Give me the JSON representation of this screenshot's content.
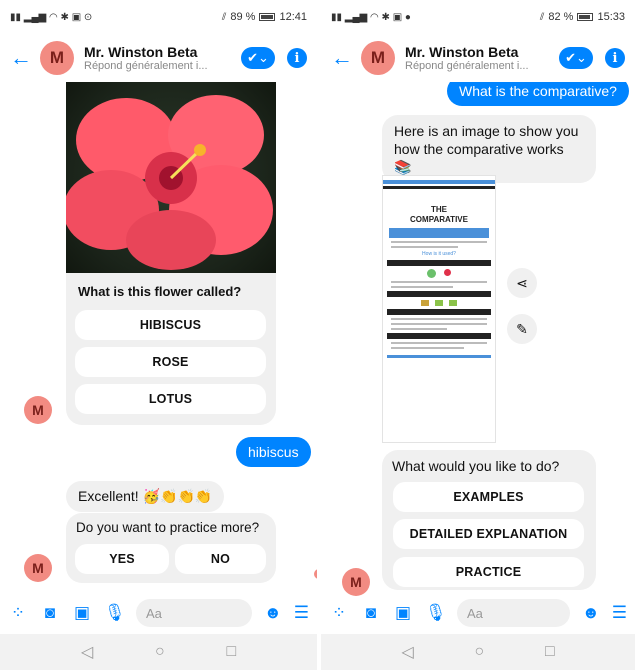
{
  "left": {
    "status": {
      "battery": "89 %",
      "time": "12:41"
    },
    "header": {
      "avatar_letter": "M",
      "name": "Mr. Winston Beta",
      "subtitle": "Répond généralement i..."
    },
    "question": "What is this flower called?",
    "options": [
      "HIBISCUS",
      "ROSE",
      "LOTUS"
    ],
    "user_reply": "hibiscus",
    "feedback": "Excellent! 🥳👏👏👏",
    "prompt": "Do you want to practice more?",
    "yes_no": [
      "YES",
      "NO"
    ],
    "avatar_letter": "M",
    "composer_placeholder": "Aa"
  },
  "right": {
    "status": {
      "battery": "82 %",
      "time": "15:33"
    },
    "header": {
      "avatar_letter": "M",
      "name": "Mr. Winston Beta",
      "subtitle": "Répond généralement i..."
    },
    "user_question": "What is the comparative?",
    "bot_reply": "Here is an image to show you how the comparative works 📚",
    "infographic": {
      "title_line1": "THE",
      "title_line2": "COMPARATIVE",
      "subheading": "How is it used?"
    },
    "prompt": "What would you like to do?",
    "options": [
      "EXAMPLES",
      "DETAILED EXPLANATION",
      "PRACTICE"
    ],
    "avatar_letter": "M",
    "composer_placeholder": "Aa"
  },
  "colors": {
    "accent": "#0084ff",
    "avatar": "#f28b82",
    "bubble": "#f0f0f0"
  }
}
